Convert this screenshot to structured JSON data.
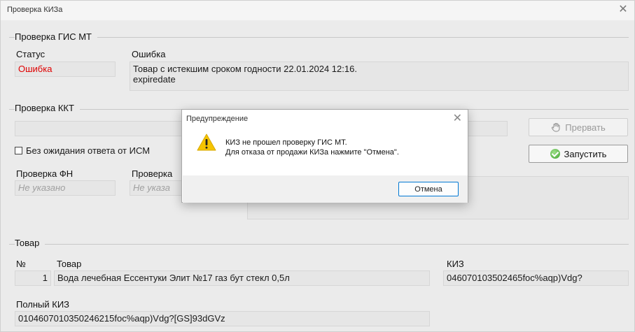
{
  "window": {
    "title": "Проверка КИЗа"
  },
  "gis": {
    "group_title": "Проверка ГИС МТ",
    "status_label": "Статус",
    "status_value": "Ошибка",
    "error_label": "Ошибка",
    "error_line1": "Товар с истекшим сроком годности 22.01.2024 12:16.",
    "error_line2": "expiredate"
  },
  "kkt": {
    "group_title": "Проверка ККТ",
    "stop_button": "Прервать",
    "start_button": "Запустить",
    "no_wait_checkbox": "Без ожидания ответа от ИСМ",
    "fn_label": "Проверка ФН",
    "fn_value": "Не указано",
    "second_label": "Проверка",
    "second_value": "Не указа"
  },
  "goods": {
    "group_title": "Товар",
    "col_no": "№",
    "col_item": "Товар",
    "col_kiz": "КИЗ",
    "row_no": "1",
    "row_item": "Вода лечебная  Ессентуки Элит №17 газ бут стекл 0,5л",
    "row_kiz": "046070103502465foc%aqp)Vdg?",
    "full_kiz_label": "Полный КИЗ",
    "full_kiz_value": "0104607010350246215foc%aqp)Vdg?[GS]93dGVz"
  },
  "dialog": {
    "title": "Предупреждение",
    "line1": "КИЗ не прошел проверку ГИС МТ.",
    "line2": "Для отказа от продажи КИЗа нажмите \"Отмена\".",
    "cancel_button": "Отмена"
  },
  "icons": {
    "close": "close-icon",
    "hand": "hand-icon",
    "ok": "check-circle-icon",
    "warning": "warning-icon"
  },
  "colors": {
    "error_text": "#e00000",
    "accent": "#0078d4",
    "warning": "#f5c400"
  }
}
